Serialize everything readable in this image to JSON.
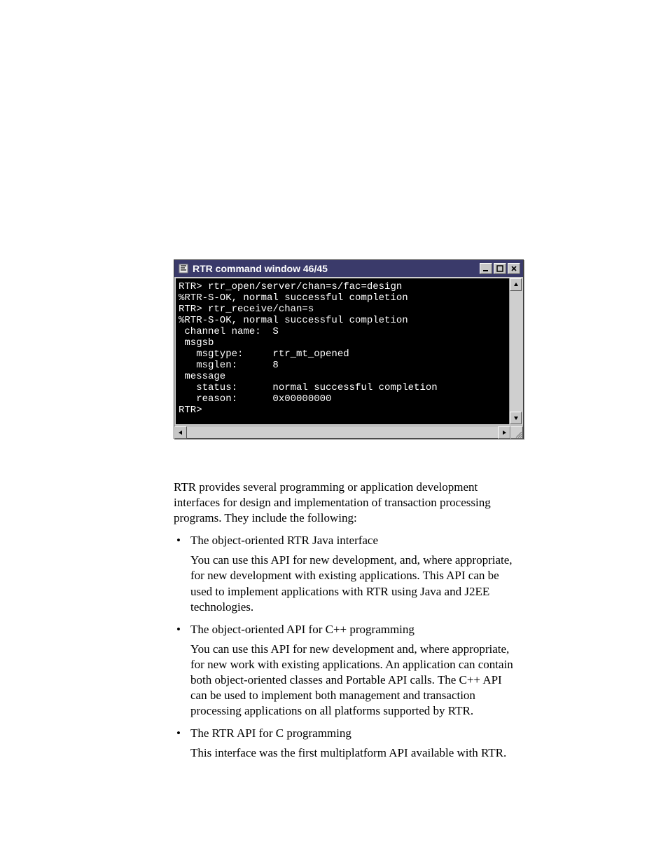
{
  "window": {
    "title": "RTR command window 46/45",
    "icon": "rtr-app-icon"
  },
  "terminal": {
    "lines": [
      "RTR> rtr_open/server/chan=s/fac=design",
      "%RTR-S-OK, normal successful completion",
      "RTR> rtr_receive/chan=s",
      "%RTR-S-OK, normal successful completion",
      " channel name:  S",
      " msgsb",
      "   msgtype:     rtr_mt_opened",
      "   msglen:      8",
      " message",
      "   status:      normal successful completion",
      "   reason:      0x00000000",
      "RTR>"
    ]
  },
  "body": {
    "intro": "RTR provides several programming or application development interfaces for design and implementation of transaction processing programs. They include the following:",
    "bullets": [
      {
        "title": "The object-oriented RTR Java interface",
        "detail": "You can use this API for new development, and, where appropriate, for new development with existing applications. This API can be used to implement applications with RTR using Java and J2EE technologies."
      },
      {
        "title": "The object-oriented API for C++ programming",
        "detail": "You can use this API for new development and, where appropriate, for new work with existing applications. An application can contain both object-oriented classes and Portable API calls. The C++ API can be used to implement both management and transaction processing applications on all platforms supported by RTR."
      },
      {
        "title": "The RTR API for C programming",
        "detail": "This interface was the first multiplatform API available with RTR."
      }
    ]
  }
}
